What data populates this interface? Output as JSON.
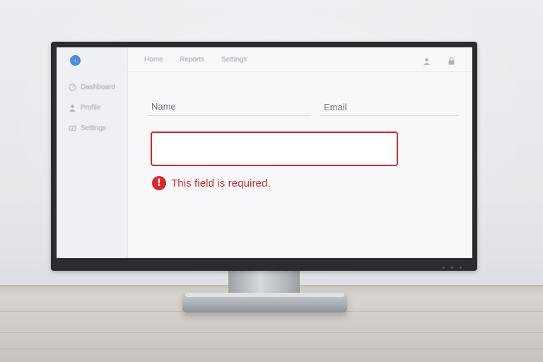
{
  "app": {
    "logo_glyph": "‹"
  },
  "sidebar": {
    "items": [
      {
        "label": "Dashboard",
        "icon": "dashboard-icon"
      },
      {
        "label": "Profile",
        "icon": "user-icon"
      },
      {
        "label": "Settings",
        "icon": "settings-icon"
      }
    ]
  },
  "topnav": {
    "links": [
      "Home",
      "Reports",
      "Settings"
    ],
    "icons": [
      "user-icon",
      "lock-icon"
    ]
  },
  "form": {
    "name_label": "Name",
    "email_label": "Email",
    "input_value": "",
    "error_icon": "!",
    "error_message": "This field is required."
  },
  "colors": {
    "error": "#d9262b",
    "accent": "#4a90d9"
  }
}
